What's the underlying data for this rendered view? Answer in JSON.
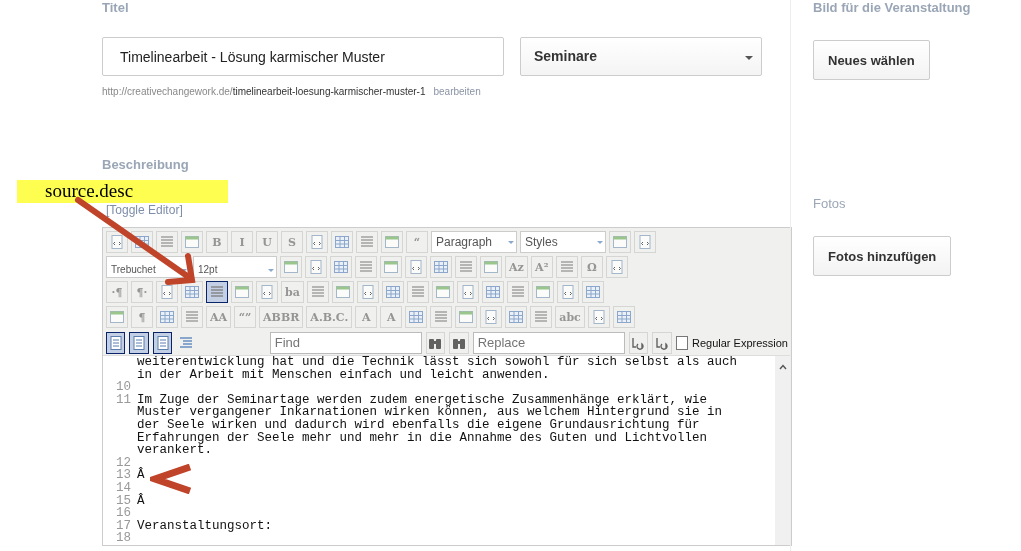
{
  "title_section": {
    "label": "Titel",
    "title_value": "Timelinearbeit - Lösung karmischer Muster",
    "category": "Seminare",
    "permalink_base": "http://creativechangework.de/",
    "permalink_slug": "timelinearbeit-loesung-karmischer-muster-1",
    "permalink_edit": "bearbeiten"
  },
  "description": {
    "label": "Beschreibung",
    "toggle": "[Toggle Editor]"
  },
  "toolbar": [
    [
      {
        "kind": "icon"
      },
      {
        "kind": "icon"
      },
      {
        "kind": "icon"
      },
      {
        "kind": "icon"
      },
      {
        "kind": "glyph",
        "label": "B"
      },
      {
        "kind": "glyph",
        "label": "I"
      },
      {
        "kind": "glyph",
        "label": "U"
      },
      {
        "kind": "glyph",
        "label": "S"
      },
      {
        "kind": "icon"
      },
      {
        "kind": "icon"
      },
      {
        "kind": "icon"
      },
      {
        "kind": "icon"
      },
      {
        "kind": "glyph",
        "label": "“"
      },
      {
        "kind": "select",
        "value": "Paragraph"
      },
      {
        "kind": "select",
        "value": "Styles"
      },
      {
        "kind": "icon"
      },
      {
        "kind": "icon"
      }
    ],
    [
      {
        "kind": "select",
        "value": "Trebuchet"
      },
      {
        "kind": "select",
        "value": "12pt"
      },
      {
        "kind": "icon"
      },
      {
        "kind": "icon"
      },
      {
        "kind": "icon"
      },
      {
        "kind": "icon"
      },
      {
        "kind": "icon"
      },
      {
        "kind": "icon"
      },
      {
        "kind": "icon"
      },
      {
        "kind": "icon"
      },
      {
        "kind": "icon"
      },
      {
        "kind": "glyph",
        "label": "Az"
      },
      {
        "kind": "glyph",
        "label": "A²"
      },
      {
        "kind": "icon"
      },
      {
        "kind": "glyph",
        "label": "Ω"
      },
      {
        "kind": "icon"
      }
    ],
    [
      {
        "kind": "glyph",
        "label": "·¶"
      },
      {
        "kind": "glyph",
        "label": "¶·"
      },
      {
        "kind": "icon"
      },
      {
        "kind": "icon"
      },
      {
        "kind": "icon",
        "selected": true
      },
      {
        "kind": "icon"
      },
      {
        "kind": "icon"
      },
      {
        "kind": "glyph",
        "label": "ba"
      },
      {
        "kind": "icon"
      },
      {
        "kind": "icon"
      },
      {
        "kind": "icon"
      },
      {
        "kind": "icon"
      },
      {
        "kind": "icon"
      },
      {
        "kind": "icon"
      },
      {
        "kind": "icon"
      },
      {
        "kind": "icon"
      },
      {
        "kind": "icon"
      },
      {
        "kind": "icon"
      },
      {
        "kind": "icon"
      },
      {
        "kind": "icon"
      }
    ],
    [
      {
        "kind": "icon"
      },
      {
        "kind": "glyph",
        "label": "¶"
      },
      {
        "kind": "icon"
      },
      {
        "kind": "icon"
      },
      {
        "kind": "glyph",
        "label": "AA"
      },
      {
        "kind": "glyph",
        "label": "“”"
      },
      {
        "kind": "glyph",
        "label": "ABBR"
      },
      {
        "kind": "glyph",
        "label": "A.B.C."
      },
      {
        "kind": "glyph",
        "label": "A"
      },
      {
        "kind": "glyph",
        "label": "A"
      },
      {
        "kind": "icon"
      },
      {
        "kind": "icon"
      },
      {
        "kind": "icon"
      },
      {
        "kind": "icon"
      },
      {
        "kind": "icon"
      },
      {
        "kind": "icon"
      },
      {
        "kind": "glyph",
        "label": "abc"
      },
      {
        "kind": "icon"
      },
      {
        "kind": "icon"
      }
    ]
  ],
  "search_bar": {
    "find_placeholder": "Find",
    "replace_placeholder": "Replace",
    "regex_label": "Regular Expression",
    "regex_checked": false
  },
  "code_lines": [
    {
      "text": "weiterentwicklung hat und die Technik lässt sich sowohl für sich selbst als auch"
    },
    {
      "text": "in der Arbeit mit Menschen einfach und leicht anwenden."
    },
    {
      "number": "10"
    },
    {
      "number": "11",
      "text": "Im Zuge der Seminartage werden zudem energetische Zusammenhänge erklärt, wie"
    },
    {
      "text": "Muster vergangener Inkarnationen wirken können, aus welchem Hintergrund sie in"
    },
    {
      "text": "der Seele wirken und dadurch wird ebenfalls die eigene Grundausrichtung für"
    },
    {
      "text": "Erfahrungen der Seele mehr und mehr in die Annahme des Guten und Lichtvollen"
    },
    {
      "text": "verankert."
    },
    {
      "number": "12"
    },
    {
      "number": "13",
      "text": "Â"
    },
    {
      "number": "14"
    },
    {
      "number": "15",
      "text": "Â"
    },
    {
      "number": "16"
    },
    {
      "number": "17",
      "text": "Veranstaltungsort:"
    },
    {
      "number": "18"
    }
  ],
  "sidebar": {
    "image_label": "Bild für die Veranstaltung",
    "image_button": "Neues wählen",
    "photos_label": "Fotos",
    "photos_button": "Fotos hinzufügen"
  },
  "annotation": {
    "label": "source.desc"
  }
}
